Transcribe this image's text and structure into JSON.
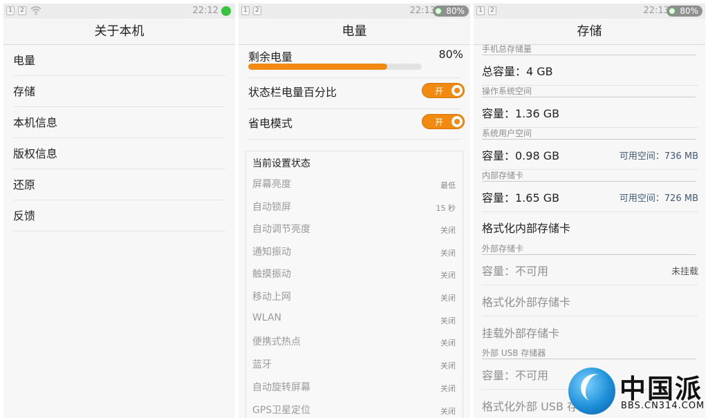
{
  "status": {
    "sim1": "1",
    "sim2": "2",
    "p1_time": "22:12",
    "p2_time": "22:13",
    "p3_time": "22:13",
    "battery": "80%"
  },
  "about": {
    "title": "关于本机",
    "items": [
      {
        "label": "电量"
      },
      {
        "label": "存储"
      },
      {
        "label": "本机信息"
      },
      {
        "label": "版权信息"
      },
      {
        "label": "还原"
      },
      {
        "label": "反馈"
      }
    ]
  },
  "power": {
    "title": "电量",
    "remaining_label": "剩余电量",
    "remaining_value": "80%",
    "remaining_fraction": 0.8,
    "percent_toggle_label": "状态栏电量百分比",
    "percent_toggle_state": "开",
    "saver_label": "省电模式",
    "saver_state": "开",
    "current_title": "当前设置状态",
    "settings": [
      {
        "key": "屏幕亮度",
        "value": "最低"
      },
      {
        "key": "自动锁屏",
        "value": "15 秒"
      },
      {
        "key": "自动调节亮度",
        "value": "关闭"
      },
      {
        "key": "通知振动",
        "value": "关闭"
      },
      {
        "key": "触摸振动",
        "value": "关闭"
      },
      {
        "key": "移动上网",
        "value": "关闭"
      },
      {
        "key": "WLAN",
        "value": "关闭"
      },
      {
        "key": "便携式热点",
        "value": "关闭"
      },
      {
        "key": "蓝牙",
        "value": "关闭"
      },
      {
        "key": "自动旋转屏幕",
        "value": "关闭"
      },
      {
        "key": "GPS卫星定位",
        "value": "关闭"
      }
    ]
  },
  "storage": {
    "title": "存储",
    "phone_total_head": "手机总存储量",
    "phone_total": "总容量：4 GB",
    "os_head": "操作系统空间",
    "os_cap": "容量：1.36 GB",
    "user_head": "系统用户空间",
    "user_cap": "容量：0.98 GB",
    "user_free": "可用空间：736 MB",
    "internal_head": "内部存储卡",
    "internal_cap": "容量：1.65 GB",
    "internal_free": "可用空间：726 MB",
    "format_internal": "格式化内部存储卡",
    "external_head": "外部存储卡",
    "external_cap": "容量：不可用",
    "external_state": "未挂载",
    "format_external": "格式化外部存储卡",
    "mount_external": "挂载外部存储卡",
    "usb_head": "外部 USB 存储器",
    "usb_cap": "容量：不可用",
    "format_usb": "格式化外部 USB 存"
  },
  "watermark": {
    "name": "中国派",
    "url": "BBS.CN314.COM"
  },
  "colors": {
    "accent": "#f08a12",
    "battery_ring": "#3ec64a",
    "link_blue": "#3d5a7a"
  }
}
